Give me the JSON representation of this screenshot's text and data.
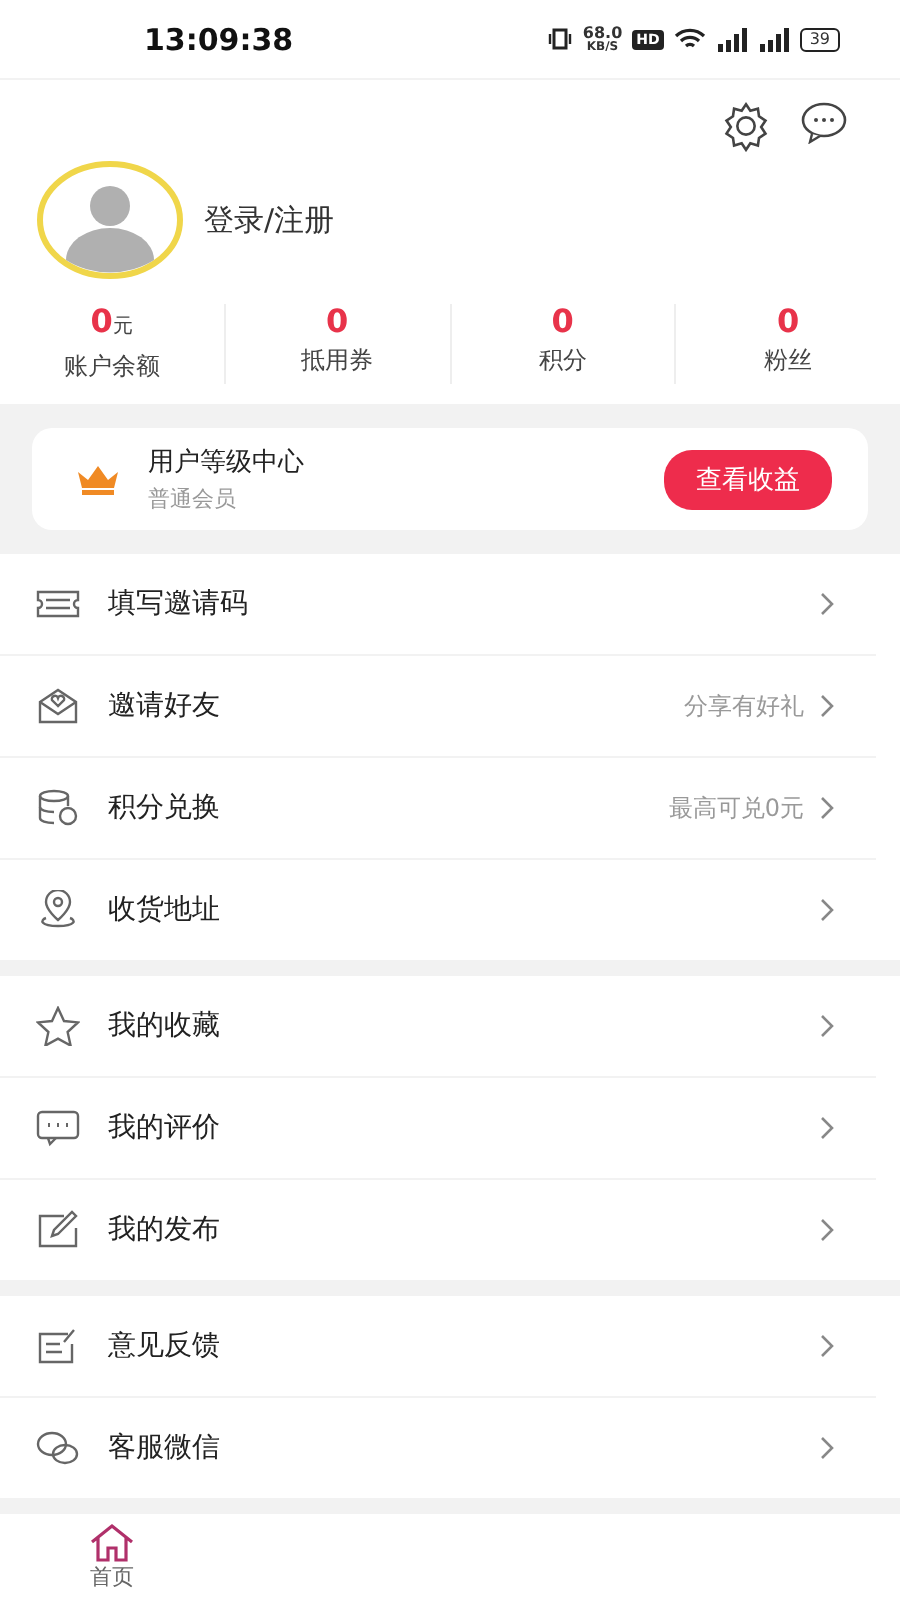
{
  "status_bar": {
    "time": "13:09:38",
    "speed": "68.0",
    "speed_unit": "KB/S",
    "hd": "HD",
    "battery": "39"
  },
  "profile": {
    "login_text": "登录/注册"
  },
  "stats": [
    {
      "value": "0",
      "unit": "元",
      "label": "账户余额"
    },
    {
      "value": "0",
      "label": "抵用券"
    },
    {
      "value": "0",
      "label": "积分"
    },
    {
      "value": "0",
      "label": "粉丝"
    }
  ],
  "level_card": {
    "title": "用户等级中心",
    "subtitle": "普通会员",
    "button": "查看收益"
  },
  "groups": [
    [
      {
        "kind": "ticket",
        "label": "填写邀请码"
      },
      {
        "kind": "envelope",
        "label": "邀请好友",
        "hint": "分享有好礼"
      },
      {
        "kind": "coins",
        "label": "积分兑换",
        "hint": "最高可兑0元"
      },
      {
        "kind": "pin",
        "label": "收货地址"
      }
    ],
    [
      {
        "kind": "star",
        "label": "我的收藏"
      },
      {
        "kind": "chat",
        "label": "我的评价"
      },
      {
        "kind": "edit",
        "label": "我的发布"
      }
    ],
    [
      {
        "kind": "note",
        "label": "意见反馈"
      },
      {
        "kind": "bubbles",
        "label": "客服微信"
      }
    ]
  ],
  "tab_bar": [
    {
      "label": "首页",
      "selected": true
    }
  ]
}
